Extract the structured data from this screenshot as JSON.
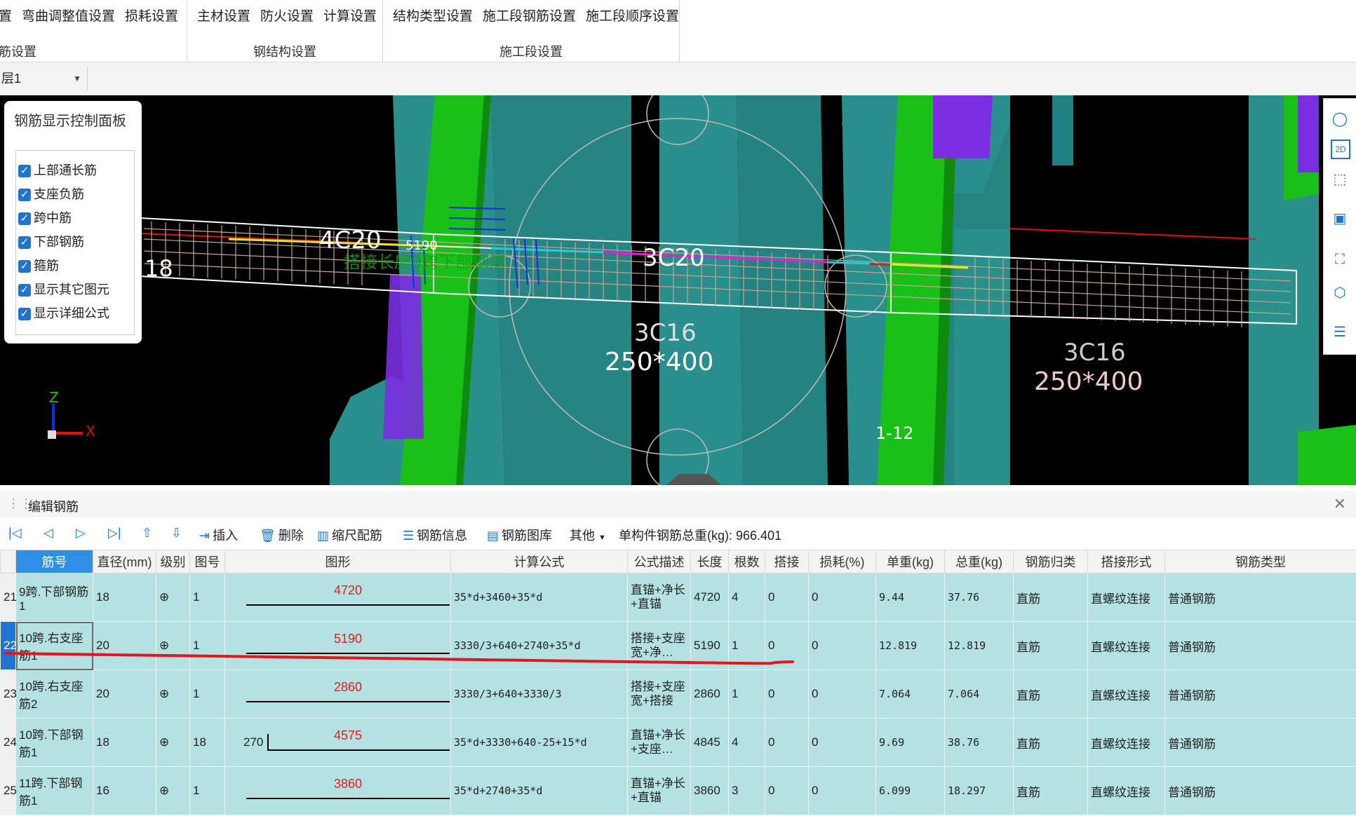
{
  "ribbon": {
    "groups": [
      {
        "items": [
          "置",
          "弯曲调整值设置",
          "损耗设置"
        ],
        "label": "筋设置"
      },
      {
        "items": [
          "主材设置",
          "防火设置",
          "计算设置"
        ],
        "label": "钢结构设置"
      },
      {
        "items": [
          "结构类型设置",
          "施工段钢筋设置",
          "施工段顺序设置"
        ],
        "label": "施工段设置"
      }
    ]
  },
  "floor_select": {
    "value": "层1"
  },
  "panel": {
    "title": "钢筋显示控制面板",
    "options": [
      "上部通长筋",
      "支座负筋",
      "跨中筋",
      "下部钢筋",
      "箍筋",
      "显示其它图元",
      "显示详细公式"
    ]
  },
  "viewport": {
    "labels": {
      "top_left": "4C20",
      "top_mid": "3C20",
      "dim": "5190",
      "bot_mid": "3C16",
      "size_mid": "250*400",
      "bot_right": "3C16",
      "size_right": "250*400",
      "left_edge": "18",
      "axis_label": "1-12",
      "axis_x": "X",
      "axis_z": "Z",
      "green_text": "搭接长度9跨下部钢筋"
    }
  },
  "editor": {
    "title": "编辑钢筋",
    "toolbar": {
      "insert": "插入",
      "delete": "删除",
      "scale": "缩尺配筋",
      "info": "钢筋信息",
      "library": "钢筋图库",
      "other": "其他",
      "total_label": "单构件钢筋总重(kg):",
      "total_value": "966.401"
    },
    "columns": [
      "筋号",
      "直径(mm)",
      "级别",
      "图号",
      "图形",
      "计算公式",
      "公式描述",
      "长度",
      "根数",
      "搭接",
      "损耗(%)",
      "单重(kg)",
      "总重(kg)",
      "钢筋归类",
      "搭接形式",
      "钢筋类型"
    ],
    "rows": [
      {
        "n": "21",
        "name": "9跨.下部钢筋1",
        "dia": "18",
        "grade": "⊕",
        "fig": "1",
        "shape_left": "",
        "shape": "4720",
        "formula": "35*d+3460+35*d",
        "desc": "直锚+净长+直锚",
        "len": "4720",
        "count": "4",
        "lap": "0",
        "loss": "0",
        "unit": "9.44",
        "total": "37.76",
        "cat": "直筋",
        "lap_type": "直螺纹连接",
        "type": "普通钢筋"
      },
      {
        "n": "22",
        "name": "10跨.右支座筋1",
        "dia": "20",
        "grade": "⊕",
        "fig": "1",
        "shape_left": "",
        "shape": "5190",
        "formula": "3330/3+640+2740+35*d",
        "desc": "搭接+支座宽+净…",
        "len": "5190",
        "count": "1",
        "lap": "0",
        "loss": "0",
        "unit": "12.819",
        "total": "12.819",
        "cat": "直筋",
        "lap_type": "直螺纹连接",
        "type": "普通钢筋"
      },
      {
        "n": "23",
        "name": "10跨.右支座筋2",
        "dia": "20",
        "grade": "⊕",
        "fig": "1",
        "shape_left": "",
        "shape": "2860",
        "formula": "3330/3+640+3330/3",
        "desc": "搭接+支座宽+搭接",
        "len": "2860",
        "count": "1",
        "lap": "0",
        "loss": "0",
        "unit": "7.064",
        "total": "7.064",
        "cat": "直筋",
        "lap_type": "直螺纹连接",
        "type": "普通钢筋"
      },
      {
        "n": "24",
        "name": "10跨.下部钢筋1",
        "dia": "18",
        "grade": "⊕",
        "fig": "18",
        "shape_left": "270",
        "shape": "4575",
        "formula": "35*d+3330+640-25+15*d",
        "desc": "直锚+净长+支座…",
        "len": "4845",
        "count": "4",
        "lap": "0",
        "loss": "0",
        "unit": "9.69",
        "total": "38.76",
        "cat": "直筋",
        "lap_type": "直螺纹连接",
        "type": "普通钢筋"
      },
      {
        "n": "25",
        "name": "11跨.下部钢筋1",
        "dia": "16",
        "grade": "⊕",
        "fig": "1",
        "shape_left": "",
        "shape": "3860",
        "formula": "35*d+2740+35*d",
        "desc": "直锚+净长+直锚",
        "len": "3860",
        "count": "3",
        "lap": "0",
        "loss": "0",
        "unit": "6.099",
        "total": "18.297",
        "cat": "直筋",
        "lap_type": "直螺纹连接",
        "type": "普通钢筋"
      }
    ]
  }
}
